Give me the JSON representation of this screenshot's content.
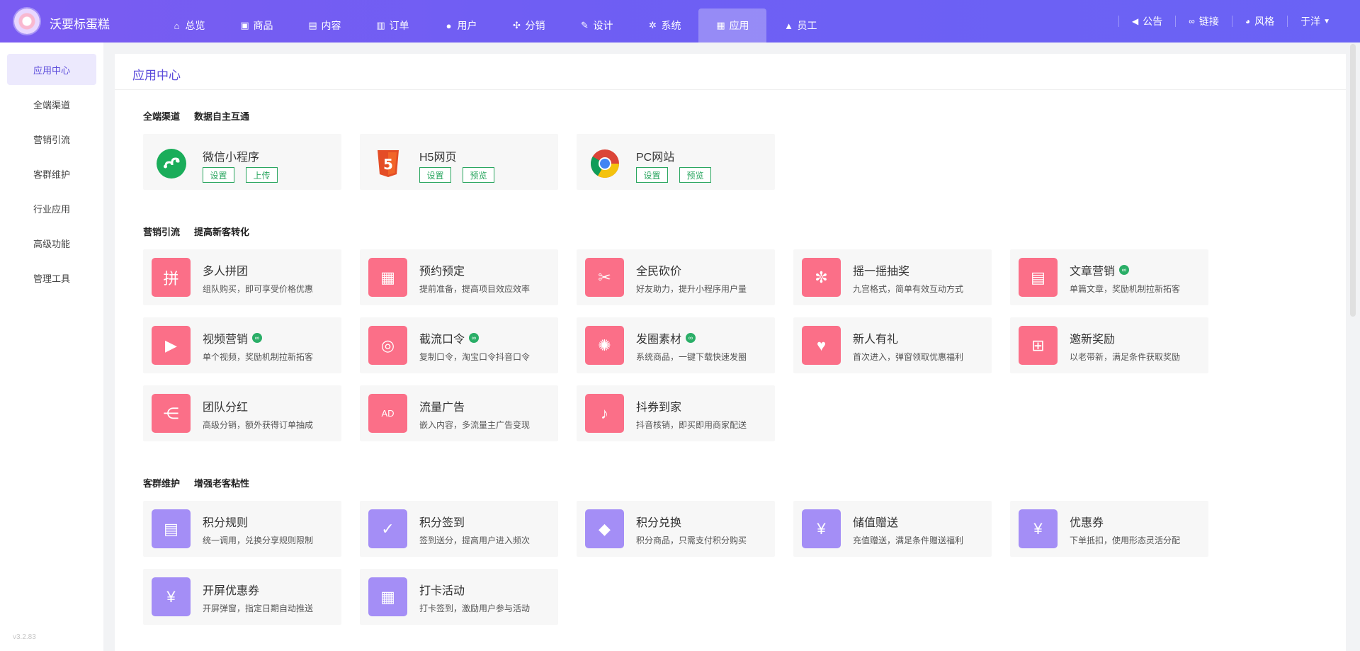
{
  "header": {
    "brand": "沃要标蛋糕",
    "nav": [
      {
        "label": "总览",
        "icon": "home-icon",
        "glyph": "⌂"
      },
      {
        "label": "商品",
        "icon": "bag-icon",
        "glyph": "▣"
      },
      {
        "label": "内容",
        "icon": "document-icon",
        "glyph": "▤"
      },
      {
        "label": "订单",
        "icon": "clipboard-icon",
        "glyph": "▥"
      },
      {
        "label": "用户",
        "icon": "user-icon",
        "glyph": "●"
      },
      {
        "label": "分销",
        "icon": "share-icon",
        "glyph": "✣"
      },
      {
        "label": "设计",
        "icon": "brush-icon",
        "glyph": "✎"
      },
      {
        "label": "系统",
        "icon": "gear-icon",
        "glyph": "✲"
      },
      {
        "label": "应用",
        "icon": "grid-icon",
        "glyph": "▦"
      },
      {
        "label": "员工",
        "icon": "lock-icon",
        "glyph": "▲"
      }
    ],
    "active_nav": "应用",
    "tools": [
      {
        "label": "公告",
        "icon": "megaphone-icon",
        "glyph": "◀"
      },
      {
        "label": "链接",
        "icon": "link-icon",
        "glyph": "∞"
      },
      {
        "label": "风格",
        "icon": "palette-icon",
        "glyph": "◕"
      }
    ],
    "user": "于洋"
  },
  "sidebar": {
    "items": [
      "应用中心",
      "全端渠道",
      "营销引流",
      "客群维护",
      "行业应用",
      "高级功能",
      "管理工具"
    ],
    "active": "应用中心",
    "version": "v3.2.83"
  },
  "main": {
    "title": "应用中心",
    "sections": {
      "channels": {
        "title": "全端渠道",
        "subtitle": "数据自主互通"
      },
      "marketing": {
        "title": "营销引流",
        "subtitle": "提高新客转化"
      },
      "retention": {
        "title": "客群维护",
        "subtitle": "增强老客粘性"
      }
    },
    "channels": [
      {
        "name": "微信小程序",
        "icon": "wechat-miniprogram-icon",
        "btn1": "设置",
        "btn2": "上传"
      },
      {
        "name": "H5网页",
        "icon": "html5-icon",
        "btn1": "设置",
        "btn2": "预览"
      },
      {
        "name": "PC网站",
        "icon": "chrome-icon",
        "btn1": "设置",
        "btn2": "预览"
      }
    ],
    "marketing": [
      {
        "name": "多人拼团",
        "desc": "组队购买，即可享受价格优惠",
        "icon": "group-buy-icon",
        "glyph": "拼",
        "mini": false
      },
      {
        "name": "预约预定",
        "desc": "提前准备，提高项目效应效率",
        "icon": "calendar-icon",
        "glyph": "▦",
        "mini": false
      },
      {
        "name": "全民砍价",
        "desc": "好友助力，提升小程序用户量",
        "icon": "price-cut-icon",
        "glyph": "✂",
        "mini": false
      },
      {
        "name": "摇一摇抽奖",
        "desc": "九宫格式，简单有效互动方式",
        "icon": "wheel-icon",
        "glyph": "✼",
        "mini": false
      },
      {
        "name": "文章营销",
        "desc": "单篇文章，奖励机制拉新拓客",
        "icon": "article-icon",
        "glyph": "▤",
        "mini": true
      },
      {
        "name": "视频营销",
        "desc": "单个视频，奖励机制拉新拓客",
        "icon": "video-icon",
        "glyph": "▶",
        "mini": true
      },
      {
        "name": "截流口令",
        "desc": "复制口令，淘宝口令抖音口令",
        "icon": "search-bubble-icon",
        "glyph": "◎",
        "mini": true
      },
      {
        "name": "发圈素材",
        "desc": "系统商品，一键下载快速发圈",
        "icon": "aperture-icon",
        "glyph": "✺",
        "mini": true
      },
      {
        "name": "新人有礼",
        "desc": "首次进入，弹窗领取优惠福利",
        "icon": "gift-hand-icon",
        "glyph": "♥",
        "mini": false
      },
      {
        "name": "邀新奖励",
        "desc": "以老带新，满足条件获取奖励",
        "icon": "gift-icon",
        "glyph": "⊞",
        "mini": false
      },
      {
        "name": "团队分红",
        "desc": "高级分销，额外获得订单抽成",
        "icon": "share-nodes-icon",
        "glyph": "⋲",
        "mini": false
      },
      {
        "name": "流量广告",
        "desc": "嵌入内容，多流量主广告变现",
        "icon": "ad-icon",
        "glyph": "AD",
        "mini": false
      },
      {
        "name": "抖券到家",
        "desc": "抖音核销，即买即用商家配送",
        "icon": "tiktok-ticket-icon",
        "glyph": "♪",
        "mini": false
      }
    ],
    "retention": [
      {
        "name": "积分规则",
        "desc": "统一调用，兑换分享规则限制",
        "icon": "rules-card-icon",
        "glyph": "▤"
      },
      {
        "name": "积分签到",
        "desc": "签到送分，提高用户进入频次",
        "icon": "calendar-check-icon",
        "glyph": "✓"
      },
      {
        "name": "积分兑换",
        "desc": "积分商品，只需支付积分购买",
        "icon": "diamond-icon",
        "glyph": "◆"
      },
      {
        "name": "储值赠送",
        "desc": "充值赠送，满足条件赠送福利",
        "icon": "money-bag-icon",
        "glyph": "¥"
      },
      {
        "name": "优惠券",
        "desc": "下单抵扣，使用形态灵活分配",
        "icon": "coupon-icon",
        "glyph": "¥"
      },
      {
        "name": "开屏优惠券",
        "desc": "开屏弹窗，指定日期自动推送",
        "icon": "screen-coupon-icon",
        "glyph": "¥"
      },
      {
        "name": "打卡活动",
        "desc": "打卡签到，激励用户参与活动",
        "icon": "checkin-calendar-icon",
        "glyph": "▦"
      }
    ]
  }
}
